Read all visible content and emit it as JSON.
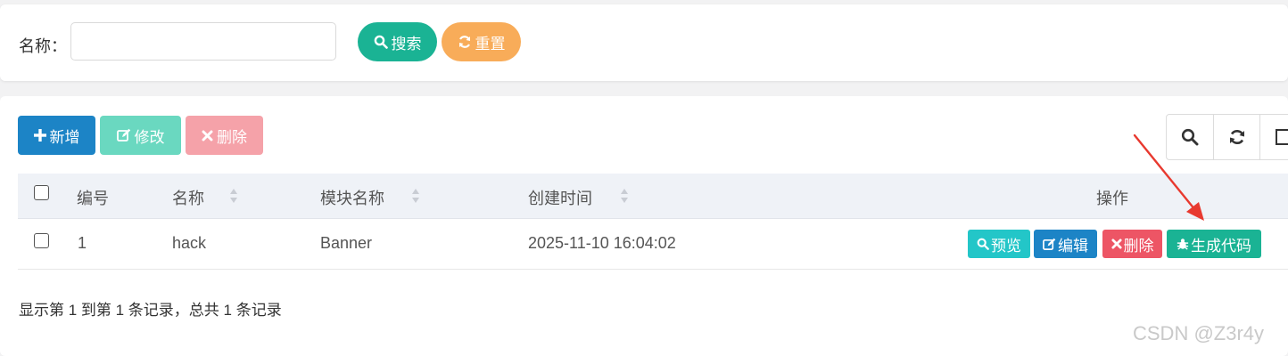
{
  "search": {
    "name_label": "名称：",
    "name_value": "",
    "name_placeholder": "",
    "search_label": "搜索",
    "reset_label": "重置"
  },
  "toolbar": {
    "add_label": "新增",
    "edit_label": "修改",
    "delete_label": "删除"
  },
  "table": {
    "columns": [
      "编号",
      "名称",
      "模块名称",
      "创建时间",
      "操作"
    ],
    "rows": [
      {
        "id": "1",
        "name": "hack",
        "module": "Banner",
        "created": "2025-11-10 16:04:02",
        "actions": [
          "预览",
          "编辑",
          "删除",
          "生成代码"
        ]
      }
    ]
  },
  "footer": {
    "summary": "显示第 1 到第 1 条记录，总共 1 条记录"
  },
  "watermark": "CSDN @Z3r4y",
  "colors": {
    "primary": "#1ab394",
    "warning": "#f8ac59",
    "info": "#1c84c6",
    "danger": "#ed5565",
    "preview": "#23c6c8",
    "annotation_arrow": "#e8392f"
  }
}
